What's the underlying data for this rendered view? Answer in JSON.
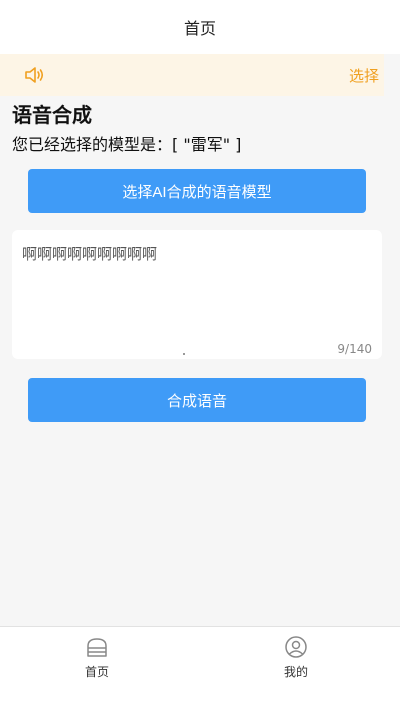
{
  "header": {
    "title": "首页"
  },
  "notice": {
    "text": "选择",
    "icon": "speaker-icon",
    "color": "#f0a020",
    "background": "#fdf5e6"
  },
  "section": {
    "title": "语音合成",
    "model_prefix": "您已经选择的模型是：",
    "model_value": "[ \"雷军\" ]"
  },
  "select_button": {
    "label": "选择AI合成的语音模型"
  },
  "text_input": {
    "value": "啊啊啊啊啊啊啊啊啊",
    "counter": "9/140"
  },
  "synth_button": {
    "label": "合成语音"
  },
  "tabbar": {
    "items": [
      {
        "label": "首页",
        "icon": "home-icon"
      },
      {
        "label": "我的",
        "icon": "user-icon"
      }
    ]
  },
  "colors": {
    "accent": "#3f9bf7",
    "background": "#f6f6f6"
  }
}
